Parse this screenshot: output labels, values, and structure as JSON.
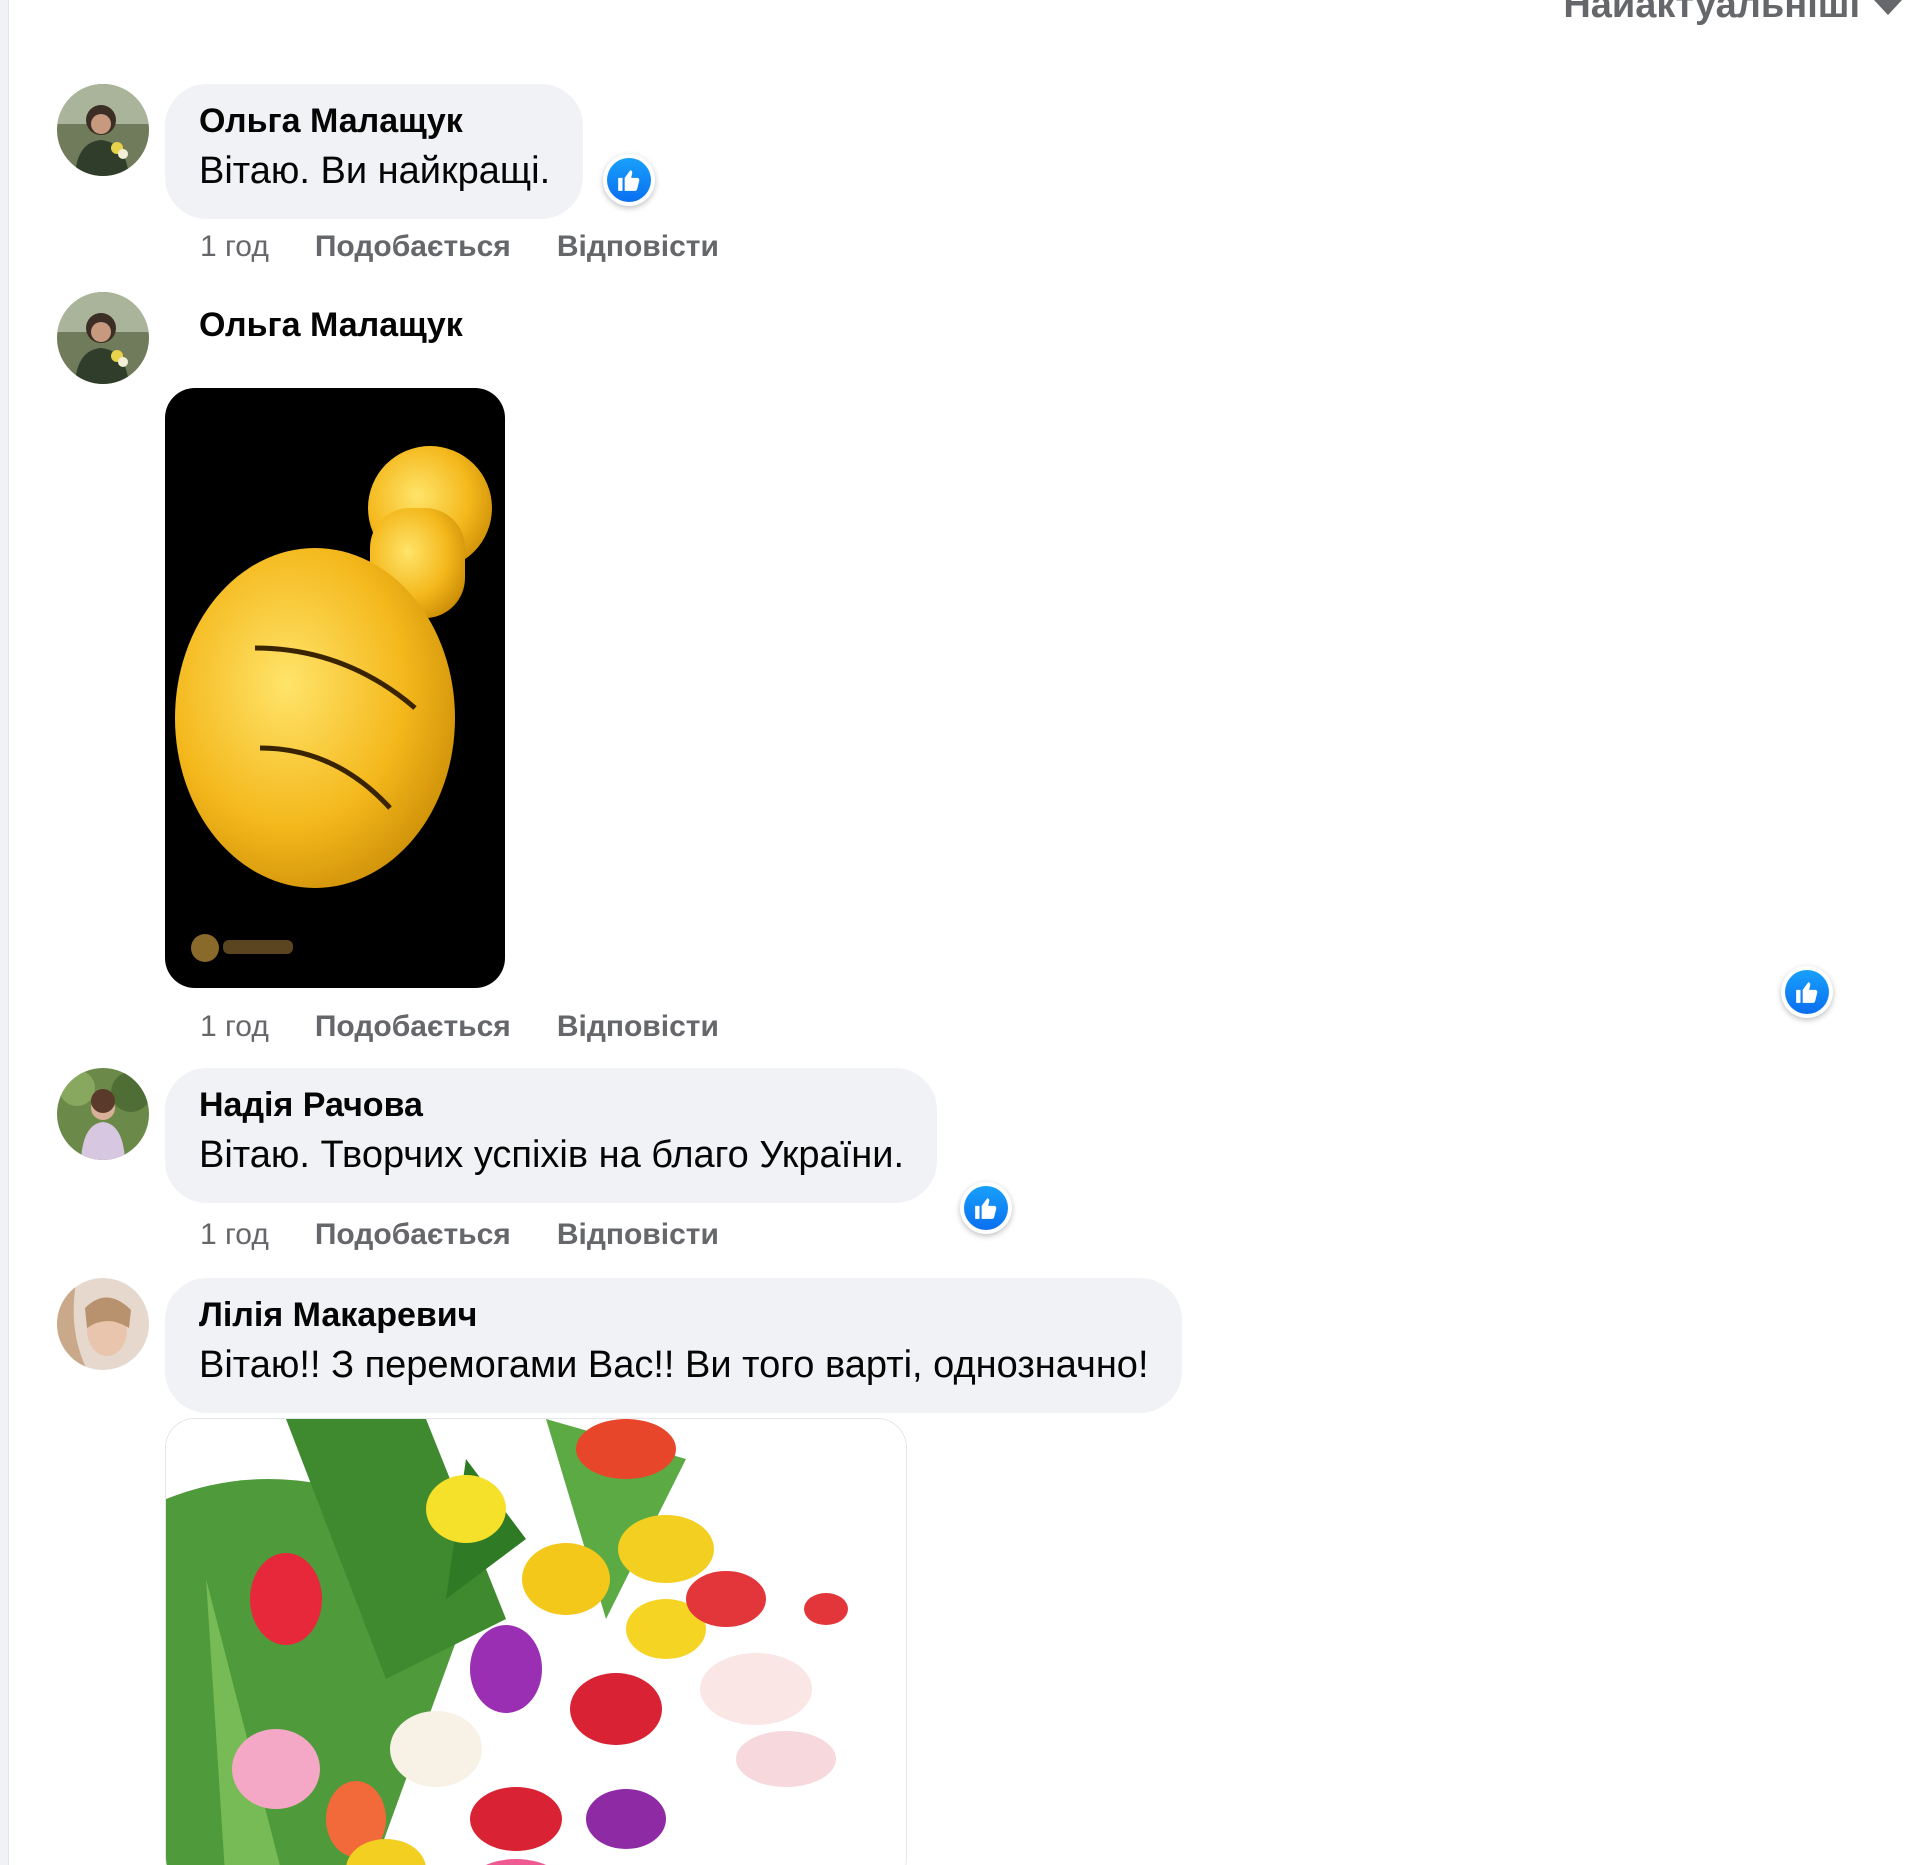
{
  "sort": {
    "label": "Найактуальніші"
  },
  "comments": [
    {
      "author": "Ольга Малащук",
      "text": "Вітаю. Ви найкращі.",
      "time": "1 год",
      "like_label": "Подобається",
      "reply_label": "Відповісти"
    },
    {
      "author": "Ольга Малащук",
      "time": "1 год",
      "like_label": "Подобається",
      "reply_label": "Відповісти"
    },
    {
      "author": "Надія Рачова",
      "text": "Вітаю. Творчих успіхів на благо України.",
      "time": "1 год",
      "like_label": "Подобається",
      "reply_label": "Відповісти"
    },
    {
      "author": "Лілія Макаревич",
      "text": "Вітаю!! З перемогами Вас!! Ви того варті, однозначно!"
    }
  ],
  "icons": {
    "reaction": "like-reaction-icon",
    "caret": "caret-down-icon"
  },
  "colors": {
    "like_blue": "#1877f2",
    "bubble_bg": "#f0f2f5",
    "secondary_text": "#65676b"
  }
}
